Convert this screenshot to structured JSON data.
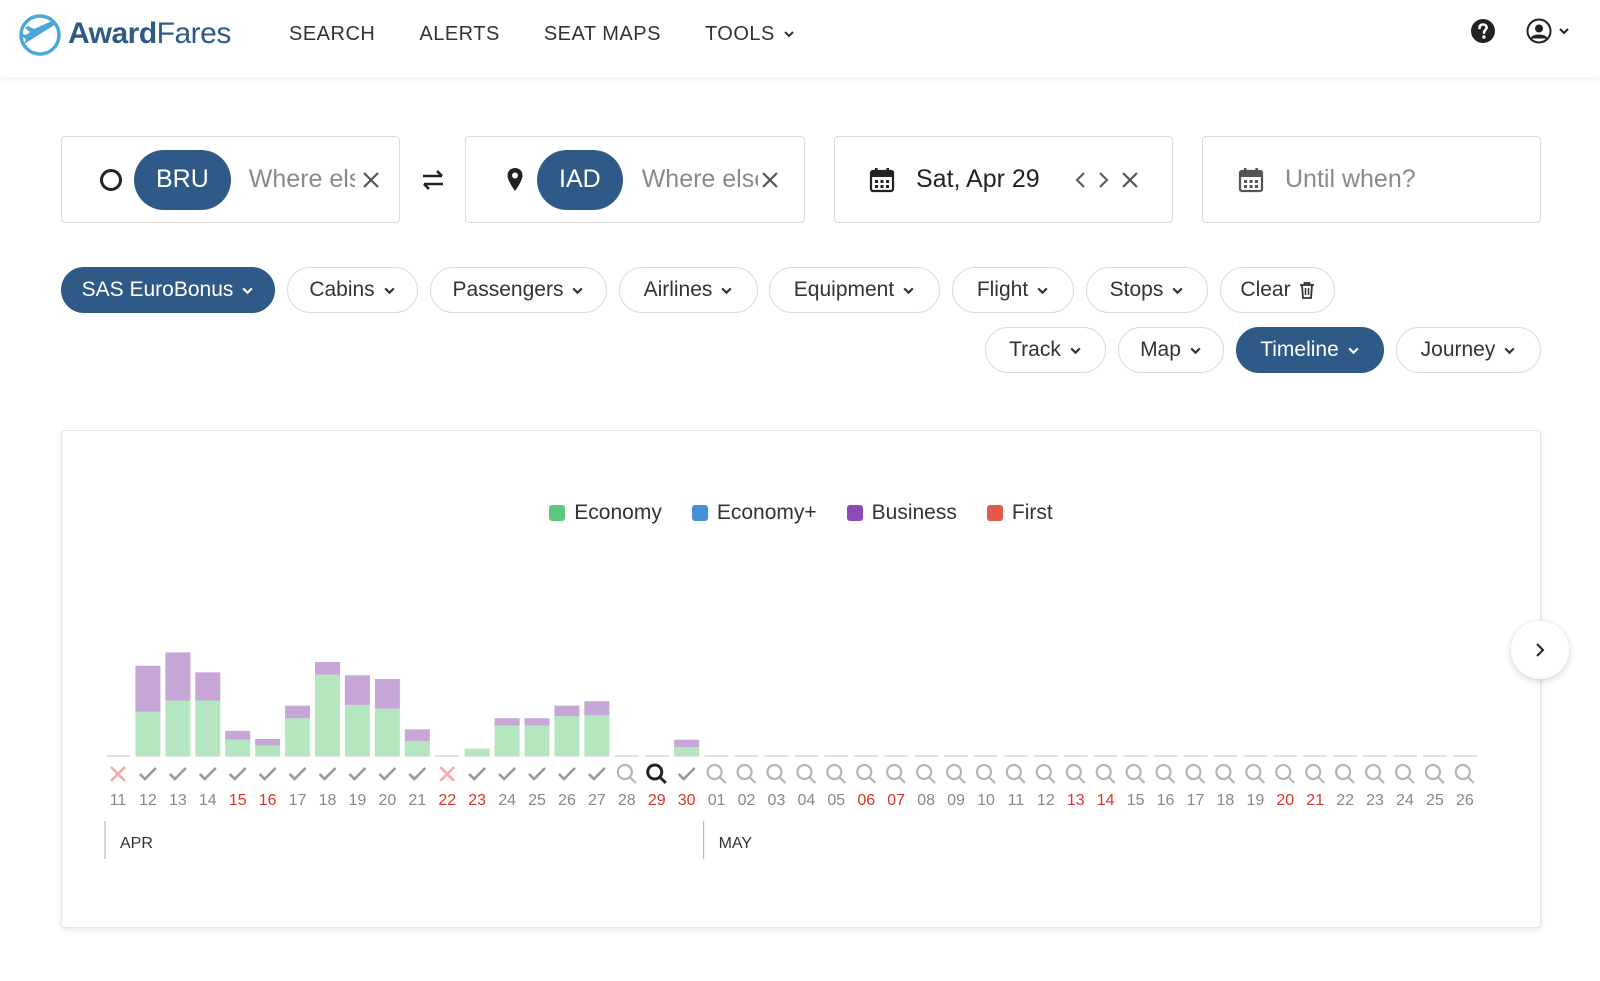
{
  "brand": {
    "part1": "Award",
    "part2": "Fares"
  },
  "nav": {
    "search": "SEARCH",
    "alerts": "ALERTS",
    "seat_maps": "SEAT MAPS",
    "tools": "TOOLS"
  },
  "search": {
    "origin_code": "BRU",
    "origin_placeholder": "Where else?",
    "destination_code": "IAD",
    "destination_placeholder": "Where else?",
    "date_value": "Sat, Apr 29",
    "until_placeholder": "Until when?"
  },
  "filters": {
    "program": "SAS EuroBonus",
    "cabins": "Cabins",
    "passengers": "Passengers",
    "airlines": "Airlines",
    "equipment": "Equipment",
    "flight": "Flight",
    "stops": "Stops",
    "clear": "Clear",
    "track": "Track",
    "map": "Map",
    "timeline": "Timeline",
    "journey": "Journey"
  },
  "colors": {
    "brand": "#2f5a87",
    "economy": "#5fc779",
    "economy_plus": "#4a90d9",
    "business": "#8e4ab6",
    "first": "#e15a4a",
    "economy_bar": "#b4e6c0",
    "business_bar": "#c5a6d6",
    "weekend": "#d9342b"
  },
  "chart_data": {
    "type": "bar",
    "stacked": true,
    "legend": [
      "Economy",
      "Economy+",
      "Business",
      "First"
    ],
    "categories": [
      "11",
      "12",
      "13",
      "14",
      "15",
      "16",
      "17",
      "18",
      "19",
      "20",
      "21",
      "22",
      "23",
      "24",
      "25",
      "26",
      "27",
      "28",
      "29",
      "30",
      "01",
      "02",
      "03",
      "04",
      "05",
      "06",
      "07",
      "08",
      "09",
      "10",
      "11",
      "12",
      "13",
      "14",
      "15",
      "16",
      "17",
      "18",
      "19",
      "20",
      "21",
      "22",
      "23",
      "24",
      "25",
      "26"
    ],
    "months": [
      {
        "label": "APR",
        "start_index": 0
      },
      {
        "label": "MAY",
        "start_index": 20
      }
    ],
    "weekend_indices": [
      4,
      5,
      11,
      12,
      18,
      19,
      25,
      26,
      32,
      33,
      39,
      40
    ],
    "status": [
      "none",
      "avail",
      "avail",
      "avail",
      "avail",
      "avail",
      "avail",
      "avail",
      "avail",
      "avail",
      "avail",
      "none",
      "avail",
      "avail",
      "avail",
      "avail",
      "avail",
      "search",
      "selected",
      "avail",
      "search",
      "search",
      "search",
      "search",
      "search",
      "search",
      "search",
      "search",
      "search",
      "search",
      "search",
      "search",
      "search",
      "search",
      "search",
      "search",
      "search",
      "search",
      "search",
      "search",
      "search",
      "search",
      "search",
      "search",
      "search",
      "search"
    ],
    "series": [
      {
        "name": "Economy",
        "values": [
          0,
          6,
          7.5,
          7.5,
          2.2,
          1.4,
          5.1,
          11,
          6.9,
          6.4,
          2,
          0,
          1,
          4.1,
          4.1,
          5.4,
          5.5,
          0,
          0,
          1.2,
          0,
          0,
          0,
          0,
          0,
          0,
          0,
          0,
          0,
          0,
          0,
          0,
          0,
          0,
          0,
          0,
          0,
          0,
          0,
          0,
          0,
          0,
          0,
          0,
          0,
          0
        ]
      },
      {
        "name": "Economy+",
        "values": [
          0,
          0,
          0,
          0,
          0,
          0,
          0,
          0,
          0,
          0,
          0,
          0,
          0,
          0,
          0,
          0,
          0,
          0,
          0,
          0,
          0,
          0,
          0,
          0,
          0,
          0,
          0,
          0,
          0,
          0,
          0,
          0,
          0,
          0,
          0,
          0,
          0,
          0,
          0,
          0,
          0,
          0,
          0,
          0,
          0,
          0
        ]
      },
      {
        "name": "Business",
        "values": [
          0,
          6.2,
          6.5,
          3.8,
          1.2,
          0.9,
          1.7,
          1.7,
          4,
          4,
          1.6,
          0,
          0,
          1,
          1,
          1.4,
          1.9,
          0,
          0,
          1,
          0,
          0,
          0,
          0,
          0,
          0,
          0,
          0,
          0,
          0,
          0,
          0,
          0,
          0,
          0,
          0,
          0,
          0,
          0,
          0,
          0,
          0,
          0,
          0,
          0,
          0
        ]
      },
      {
        "name": "First",
        "values": [
          0,
          0,
          0,
          0,
          0,
          0,
          0,
          0,
          0,
          0,
          0,
          0,
          0,
          0,
          0,
          0,
          0,
          0,
          0,
          0,
          0,
          0,
          0,
          0,
          0,
          0,
          0,
          0,
          0,
          0,
          0,
          0,
          0,
          0,
          0,
          0,
          0,
          0,
          0,
          0,
          0,
          0,
          0,
          0,
          0,
          0
        ]
      }
    ]
  }
}
